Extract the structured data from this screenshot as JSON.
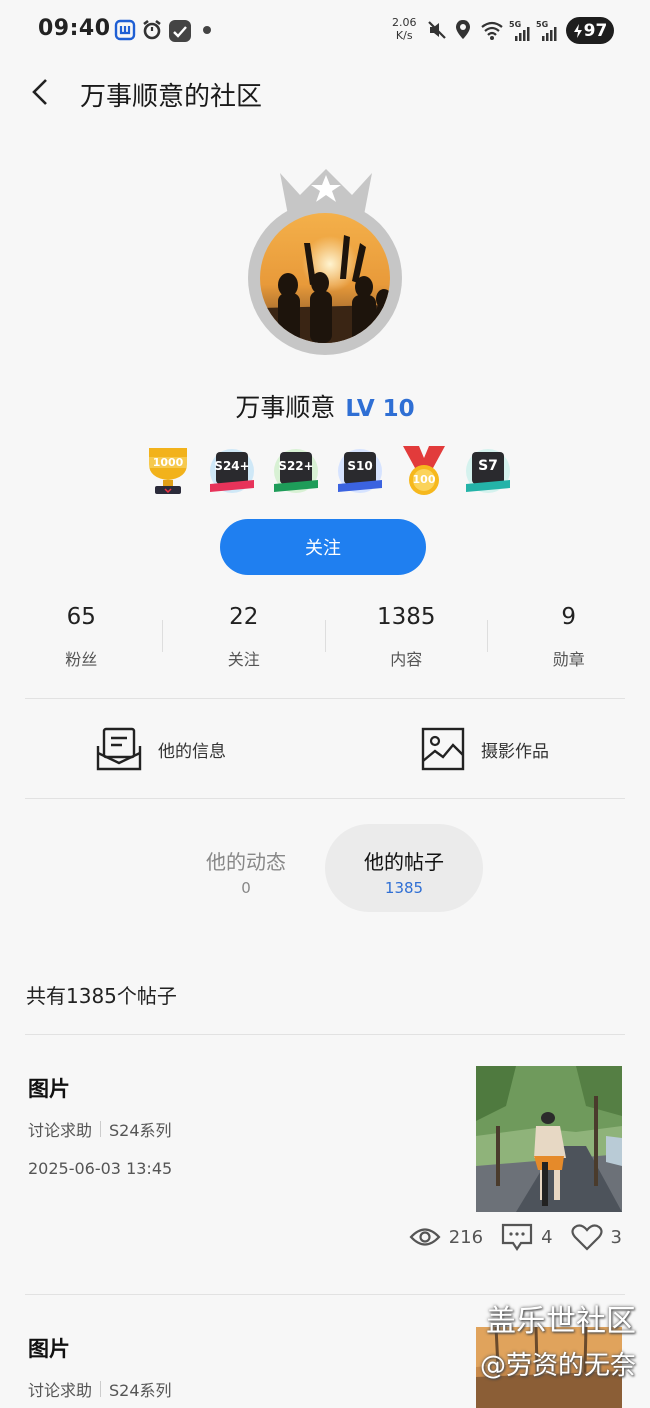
{
  "status_bar": {
    "time": "09:40",
    "net_speed_value": "2.06",
    "net_speed_unit": "K/s",
    "signal_1": "5G",
    "signal_2": "5G",
    "battery": "97"
  },
  "header": {
    "title": "万事顺意的社区"
  },
  "profile": {
    "name": "万事顺意",
    "level": "LV 10",
    "badges": [
      {
        "icon": "trophy-1000-icon",
        "text": "1000"
      },
      {
        "icon": "phone-badge-icon",
        "text": "S24+"
      },
      {
        "icon": "phone-badge-icon",
        "text": "S22+"
      },
      {
        "icon": "phone-badge-icon",
        "text": "S10"
      },
      {
        "icon": "medal-100-icon",
        "text": "100"
      },
      {
        "icon": "phone-badge-icon",
        "text": "S7"
      }
    ],
    "follow_label": "关注"
  },
  "stats": [
    {
      "value": "65",
      "label": "粉丝"
    },
    {
      "value": "22",
      "label": "关注"
    },
    {
      "value": "1385",
      "label": "内容"
    },
    {
      "value": "9",
      "label": "勋章"
    }
  ],
  "entries": {
    "info_label": "他的信息",
    "photo_label": "摄影作品"
  },
  "tabs": [
    {
      "label": "他的动态",
      "count": "0",
      "active": false
    },
    {
      "label": "他的帖子",
      "count": "1385",
      "active": true
    }
  ],
  "post_count_text": "共有1385个帖子",
  "posts": [
    {
      "title": "图片",
      "category": "讨论求助",
      "series": "S24系列",
      "date": "2025-06-03 13:45",
      "views": "216",
      "comments": "4",
      "likes": "3"
    },
    {
      "title": "图片",
      "category": "讨论求助",
      "series": "S24系列"
    }
  ],
  "watermark": {
    "line1": "盖乐世社区",
    "line2": "@劳资的无奈"
  },
  "colors": {
    "accent": "#1f7ff0",
    "level": "#2f6fd4",
    "tab_active_bg": "#ebebeb"
  }
}
